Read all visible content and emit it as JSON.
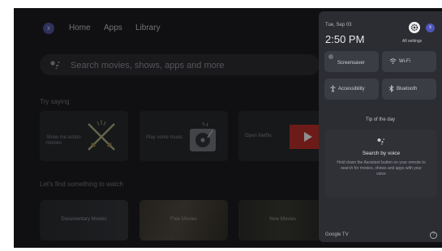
{
  "nav": {
    "avatar_initial": "x",
    "home": "Home",
    "apps": "Apps",
    "library": "Library"
  },
  "search": {
    "placeholder": "Search movies, shows, apps and more"
  },
  "try_saying": {
    "title": "Try saying",
    "cards": [
      {
        "label": "Show me action movies"
      },
      {
        "label": "Play some music"
      },
      {
        "label": "Open Netflix"
      }
    ]
  },
  "watch": {
    "title": "Let's find something to watch",
    "items": [
      {
        "label": "Documentary Movies"
      },
      {
        "label": "Free Movies"
      },
      {
        "label": "New Movies"
      }
    ]
  },
  "panel": {
    "date": "Tue, Sep 03",
    "time": "2:50 PM",
    "all_settings": "All settings",
    "avatar_initial": "x",
    "tiles": {
      "screensaver": "Screensaver",
      "wifi": "Wi-Fi",
      "accessibility": "Accessibility",
      "bluetooth": "Bluetooth"
    },
    "tip": {
      "title": "Tip of the day",
      "heading": "Search by voice",
      "body": "Hold down the Assistant button on your remote to search for movies, shows and apps with your voice"
    },
    "brand": "Google TV",
    "help_glyph": "?"
  },
  "colors": {
    "background": "#1a1b1e",
    "panel": "#2b2d33",
    "netflix_red": "#c0302a",
    "avatar": "#4f55b8"
  }
}
